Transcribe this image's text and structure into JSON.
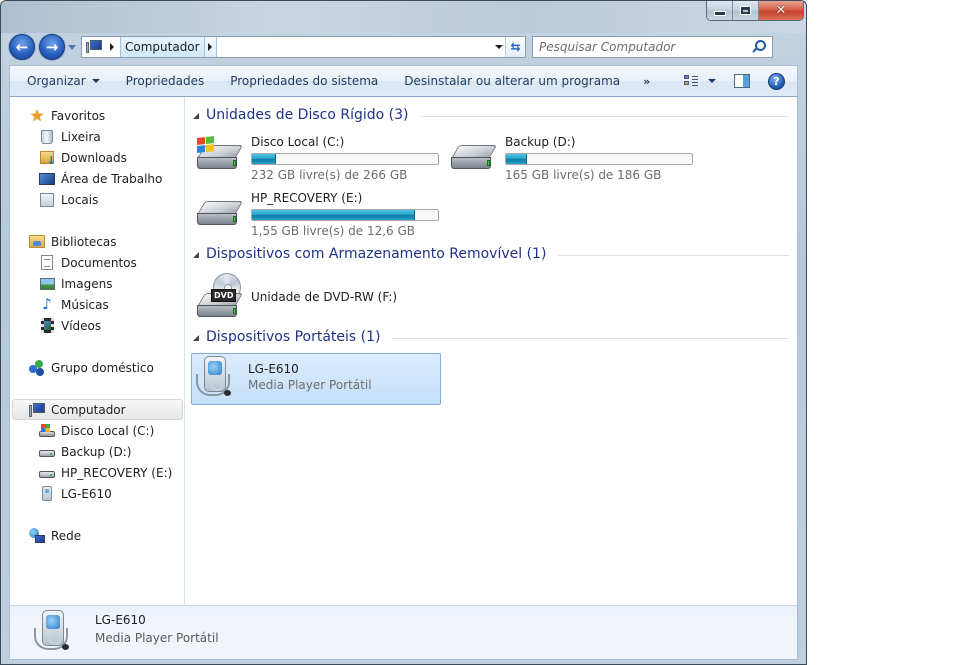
{
  "window": {
    "buttons": {
      "minimize": "minimize",
      "maximize": "maximize",
      "close": "close"
    }
  },
  "nav": {
    "back": "back",
    "forward": "forward",
    "breadcrumb": [
      "Computador"
    ],
    "search_placeholder": "Pesquisar Computador"
  },
  "toolbar": {
    "items": [
      "Organizar",
      "Propriedades",
      "Propriedades do sistema",
      "Desinstalar ou alterar um programa"
    ],
    "more": "»"
  },
  "sidebar": {
    "favorites": {
      "label": "Favoritos",
      "items": [
        "Lixeira",
        "Downloads",
        "Área de Trabalho",
        "Locais"
      ]
    },
    "libraries": {
      "label": "Bibliotecas",
      "items": [
        "Documentos",
        "Imagens",
        "Músicas",
        "Vídeos"
      ]
    },
    "homegroup": {
      "label": "Grupo doméstico"
    },
    "computer": {
      "label": "Computador",
      "items": [
        "Disco Local (C:)",
        "Backup (D:)",
        "HP_RECOVERY (E:)",
        "LG-E610"
      ]
    },
    "network": {
      "label": "Rede"
    }
  },
  "main": {
    "groups": [
      {
        "title": "Unidades de Disco Rígido (3)",
        "drives": [
          {
            "name": "Disco Local (C:)",
            "free_text": "232 GB livre(s) de 266 GB",
            "used_fraction": 0.128
          },
          {
            "name": "Backup (D:)",
            "free_text": "165 GB livre(s) de 186 GB",
            "used_fraction": 0.113
          },
          {
            "name": "HP_RECOVERY (E:)",
            "free_text": "1,55 GB livre(s) de 12,6 GB",
            "used_fraction": 0.877
          }
        ]
      },
      {
        "title": "Dispositivos com Armazenamento Removível (1)",
        "drives": [
          {
            "name": "Unidade de DVD-RW (F:)",
            "badge": "DVD"
          }
        ]
      },
      {
        "title": "Dispositivos Portáteis (1)",
        "drives": [
          {
            "name": "LG-E610",
            "type": "Media Player Portátil"
          }
        ]
      }
    ]
  },
  "details": {
    "name": "LG-E610",
    "type": "Media Player Portátil"
  },
  "colors": {
    "group_title": "#1e3287",
    "capacity_fill": "#26a4cc",
    "selection": "#c4e0fa"
  }
}
